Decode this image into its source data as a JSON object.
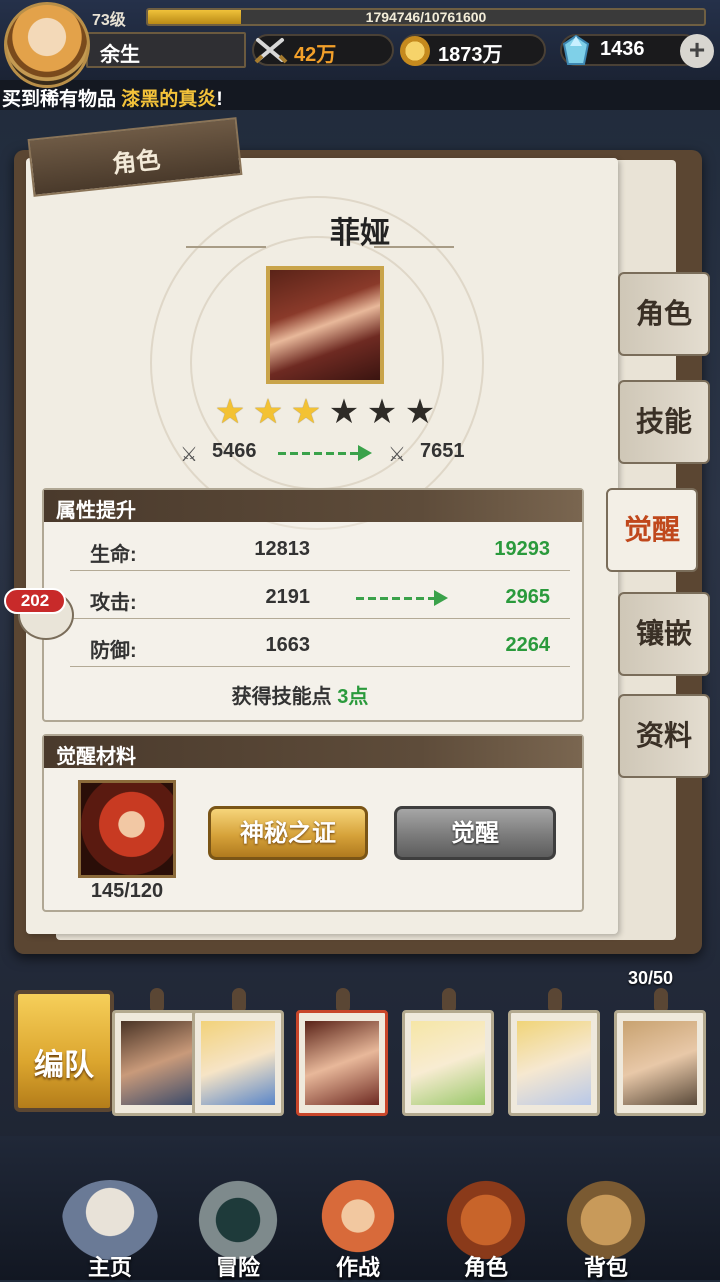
{
  "player": {
    "level": "73级",
    "exp_text": "1794746/10761600",
    "exp_progress": 0.1668,
    "name": "余生",
    "power": "42万",
    "gold": "1873万",
    "gems": "1436",
    "add_label": "+"
  },
  "ticker": {
    "prefix": "买到稀有物品",
    "item": "漆黑的真炎",
    "suffix": "!"
  },
  "panel": {
    "section_title": "角色",
    "hero_name": "菲娅",
    "stars_filled": 3,
    "stars_total": 6,
    "power_before": "5466",
    "power_after": "7651"
  },
  "attributes": {
    "title": "属性提升",
    "rows": [
      {
        "label": "生命:",
        "before": "12813",
        "after": "19293"
      },
      {
        "label": "攻击:",
        "before": "2191",
        "after": "2965"
      },
      {
        "label": "防御:",
        "before": "1663",
        "after": "2264"
      }
    ],
    "skill_points_label": "获得技能点",
    "skill_points_value": "3点"
  },
  "materials": {
    "title": "觉醒材料",
    "count": "145/120",
    "mystery_button": "神秘之证",
    "awaken_button": "觉醒"
  },
  "side_tabs": [
    {
      "label": "角色",
      "active": false
    },
    {
      "label": "技能",
      "active": false
    },
    {
      "label": "觉醒",
      "active": true
    },
    {
      "label": "镶嵌",
      "active": false
    },
    {
      "label": "资料",
      "active": false
    }
  ],
  "chat_badge": "202",
  "roster": {
    "count": "30/50",
    "team_button": "编队"
  },
  "nav": [
    {
      "label": "主页",
      "icon": "home-statue-icon"
    },
    {
      "label": "冒险",
      "icon": "adventure-portal-icon"
    },
    {
      "label": "作战",
      "icon": "battle-icon"
    },
    {
      "label": "角色",
      "icon": "character-book-icon"
    },
    {
      "label": "背包",
      "icon": "bag-icon"
    }
  ],
  "colors": {
    "accent_gold": "#f3c233",
    "stat_up_green": "#2a9a3c",
    "active_tab_red": "#c0481c",
    "badge_red": "#c82a2a"
  }
}
